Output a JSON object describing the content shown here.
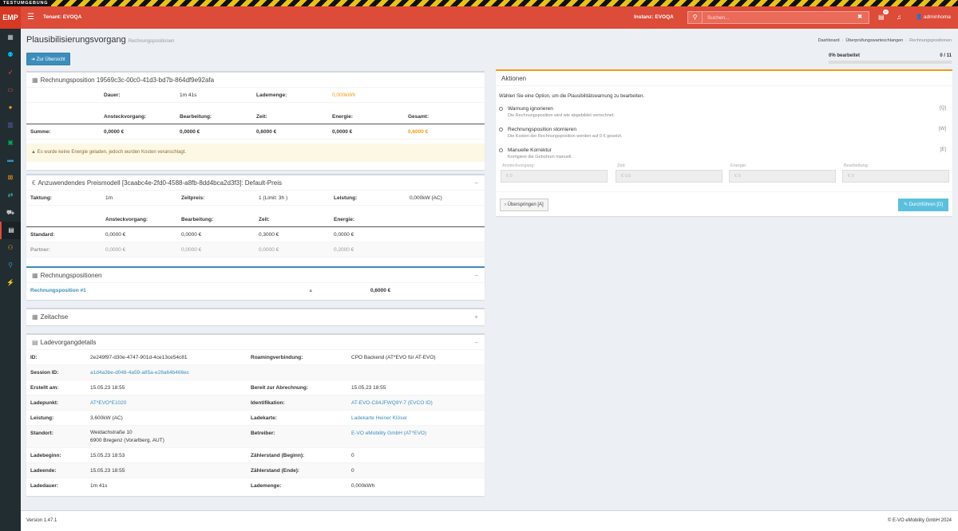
{
  "env_banner": "TESTUMGEBUNG",
  "header": {
    "logo": "EMP",
    "tenant": "Tenant: EVOQA",
    "instance": "Instanz: EVOQA",
    "search_placeholder": "Suchen...",
    "notif_count": "10",
    "user": "adminhoma",
    "accent": "#dd4b39"
  },
  "sidebar_icons": [
    "dashboard-icon",
    "users-icon",
    "rocket-icon",
    "id-card-icon",
    "coins-icon",
    "calculator-icon",
    "money-icon",
    "battery-icon",
    "map-icon",
    "exchange-icon",
    "car-icon",
    "invoice-icon",
    "group-icon",
    "user-icon",
    "plug-icon"
  ],
  "page": {
    "title": "Plausibilisierungsvorgang",
    "subtitle": "Rechnungspositionen",
    "breadcrumb": [
      "Dashboard",
      "Überprüfungswarteschlangen",
      "Rechnungspositionen"
    ],
    "back_label": "Zur Übersicht",
    "progress_label": "0% bearbeitet",
    "progress_count": "0 / 11",
    "progress_value": 0
  },
  "rechnungsposition": {
    "title": "Rechnungsposition 19569c3c-00c0-41d3-bd7b-864df9e92afa",
    "dauer_label": "Dauer:",
    "dauer_value": "1m 41s",
    "lademenge_label": "Lademenge:",
    "lademenge_value": "0,000kWh",
    "columns": [
      "Ansteckvorgang:",
      "Bearbeitung:",
      "Zeit:",
      "Energie:",
      "Gesamt:"
    ],
    "summe_label": "Summe:",
    "summe_values": [
      "0,0000 €",
      "0,0000 €",
      "0,6000 €",
      "0,0000 €",
      "0,6000 €"
    ],
    "alert": "Es wurde keine Energie geladen, jedoch wurden Kosten veranschlagt."
  },
  "preismodell": {
    "title": "Anzuwendendes Preismodell [3caabc4e-2fd0-4588-a8fb-8dd4bca2d3f3]: Default-Preis",
    "taktung_label": "Taktung:",
    "taktung_value": "1m",
    "zeitpreis_label": "Zeitpreis:",
    "zeitpreis_value": "1 (Limit: 3h )",
    "leistung_label": "Leistung:",
    "leistung_value": "0,000kW (AC)",
    "columns": [
      "Ansteckvorgang:",
      "Bearbeitung:",
      "Zeit:",
      "Energie:"
    ],
    "standard_label": "Standard:",
    "standard_values": [
      "0,0000 €",
      "0,0000 €",
      "0,3000 €",
      "0,0000 €"
    ],
    "partner_label": "Partner:",
    "partner_values": [
      "0,0000 €",
      "0,0000 €",
      "0,0000 €",
      "0,2000 €"
    ]
  },
  "positionen": {
    "title": "Rechnungspositionen",
    "item_label": "Rechnungsposition #1",
    "item_value": "0,6000 €"
  },
  "zeitachse": {
    "title": "Zeitachse"
  },
  "ladevorgang": {
    "title": "Ladevorgangdetails",
    "rows": [
      {
        "l1": "ID:",
        "v1": "2e249f97-d30e-4747-901d-4ce13ce54c81",
        "l2": "Roamingverbindung:",
        "v2": "CPO Backend (AT*EVO für AT-EVO)"
      },
      {
        "l1": "Session ID:",
        "v1": "a1d4a3be-d048-4a59-a85a-e28a64b466ec",
        "l2": "",
        "v2": ""
      },
      {
        "l1": "Erstellt am:",
        "v1": "15.05.23 18:55",
        "l2": "Bereit zur Abrechnung:",
        "v2": "15.05.23 18:55"
      },
      {
        "l1": "Ladepunkt:",
        "v1": "AT*EVO*E1020",
        "l2": "Identifikation:",
        "v2": "AT-EVO-C84JFWQ9Y-7 (EVCO ID)"
      },
      {
        "l1": "Leistung:",
        "v1": "3,600kW (AC)",
        "l2": "Ladekarte:",
        "v2": "Ladekarte Heiner Klöser"
      },
      {
        "l1": "Standort:",
        "v1": "Weidachstraße 10",
        "v1b": "6900 Bregenz (Vorarlberg, AUT)",
        "l2": "Betreiber:",
        "v2": "E-VO eMobility GmbH (AT*EVO)"
      },
      {
        "l1": "Ladebeginn:",
        "v1": "15.05.23 18:53",
        "l2": "Zählerstand (Beginn):",
        "v2": "0"
      },
      {
        "l1": "Ladeende:",
        "v1": "15.05.23 18:55",
        "l2": "Zählerstand (Ende):",
        "v2": "0"
      },
      {
        "l1": "Ladedauer:",
        "v1": "1m 41s",
        "l2": "Lademenge:",
        "v2": "0,000kWh"
      }
    ]
  },
  "aktionen": {
    "title": "Aktionen",
    "intro": "Wählen Sie eine Option, um die Plausibilitätswarnung zu bearbeiten.",
    "options": [
      {
        "label": "Warnung ignorieren",
        "desc": "Die Rechnungsposition wird wie abgebildet verrechnet.",
        "key": "[Q]"
      },
      {
        "label": "Rechnungsposition stornieren",
        "desc": "Die Kosten der Rechnungsposition werden auf 0 € gesetzt.",
        "key": "[W]"
      },
      {
        "label": "Manuelle Korrektur",
        "desc": "Korrigiere die Gebühren manuell.",
        "key": "[E]"
      }
    ],
    "correction_labels": [
      "Ansteckvorgang:",
      "Zeit:",
      "Energie:",
      "Bearbeitung:"
    ],
    "correction_placeholder": "€ 0",
    "correction_placeholder_zeit": "€ 0,6",
    "skip_label": "Überspringen [A]",
    "execute_label": "Durchführen [D]"
  },
  "footer": {
    "version": "Version 1.47.1",
    "copyright": "© E-VO eMobility GmbH 2024"
  }
}
